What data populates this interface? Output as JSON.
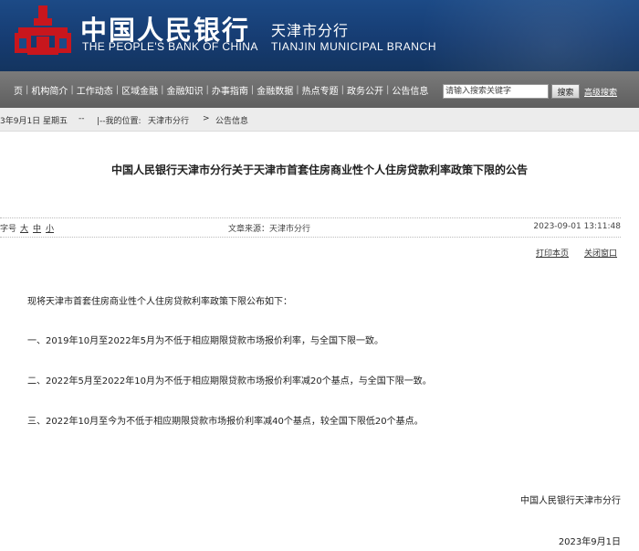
{
  "header": {
    "logo_icon": "pboc-logo-icon",
    "bank_name_cn": "中国人民银行",
    "bank_name_en": "THE PEOPLE'S BANK OF CHINA",
    "branch_name_cn": "天津市分行",
    "branch_name_en": "TIANJIN MUNICIPAL BRANCH",
    "colors": {
      "banner": "#1c4a86",
      "logo": "#c8161d"
    }
  },
  "nav": {
    "items": [
      "页",
      "机构简介",
      "工作动态",
      "区域金融",
      "金融知识",
      "办事指南",
      "金融数据",
      "热点专题",
      "政务公开",
      "公告信息"
    ],
    "search_placeholder": "请输入搜索关键字",
    "search_button": "搜索",
    "advanced_search": "高级搜索"
  },
  "infobar": {
    "date": "3年9月1日 星期五",
    "dashes": "--",
    "location_prefix": "|--我的位置:",
    "crumb_1": "天津市分行",
    "crumb_sep": ">",
    "crumb_2": "公告信息"
  },
  "article": {
    "title": "中国人民银行天津市分行关于天津市首套住房商业性个人住房贷款利率政策下限的公告",
    "font_size_label": "字号",
    "font_sizes": [
      "大",
      "中",
      "小"
    ],
    "source": "文章来源：天津市分行",
    "timestamp": "2023-09-01  13:11:48",
    "print_link": "打印本页",
    "close_link": "关闭窗口",
    "intro": "现将天津市首套住房商业性个人住房贷款利率政策下限公布如下：",
    "paragraphs": [
      "一、2019年10月至2022年5月为不低于相应期限贷款市场报价利率，与全国下限一致。",
      "二、2022年5月至2022年10月为不低于相应期限贷款市场报价利率减20个基点，与全国下限一致。",
      "三、2022年10月至今为不低于相应期限贷款市场报价利率减40个基点，较全国下限低20个基点。"
    ],
    "signature_org": "中国人民银行天津市分行",
    "signature_date": "2023年9月1日"
  }
}
